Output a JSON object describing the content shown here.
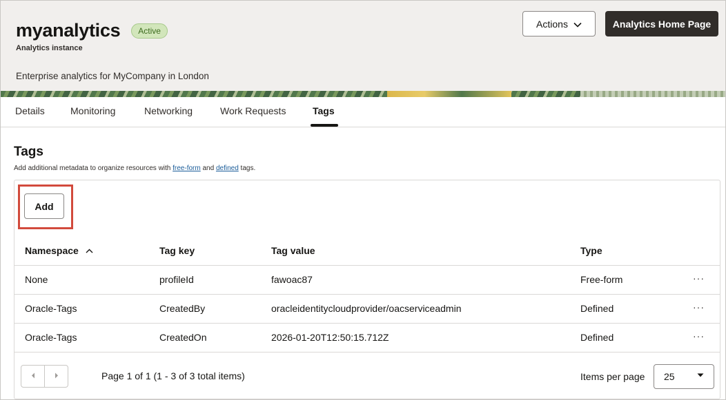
{
  "header": {
    "title": "myanalytics",
    "status": "Active",
    "subtitle": "Analytics instance",
    "description": "Enterprise analytics for MyCompany in London",
    "actions_label": "Actions",
    "home_label": "Analytics Home Page"
  },
  "tabs": [
    {
      "label": "Details"
    },
    {
      "label": "Monitoring"
    },
    {
      "label": "Networking"
    },
    {
      "label": "Work Requests"
    },
    {
      "label": "Tags",
      "active": true
    }
  ],
  "section": {
    "title": "Tags",
    "desc_prefix": "Add additional metadata to organize resources with ",
    "link_freeform": "free-form",
    "desc_and": " and ",
    "link_defined": "defined",
    "desc_suffix": " tags."
  },
  "toolbar": {
    "add_label": "Add"
  },
  "table": {
    "columns": [
      "Namespace",
      "Tag key",
      "Tag value",
      "Type"
    ],
    "rows": [
      {
        "namespace": "None",
        "key": "profileId",
        "value": "fawoac87",
        "type": "Free-form"
      },
      {
        "namespace": "Oracle-Tags",
        "key": "CreatedBy",
        "value": "oracleidentitycloudprovider/oacserviceadmin",
        "type": "Defined"
      },
      {
        "namespace": "Oracle-Tags",
        "key": "CreatedOn",
        "value": "2026-01-20T12:50:15.712Z",
        "type": "Defined"
      }
    ],
    "row_menu": "···"
  },
  "pager": {
    "page_info": "Page 1 of 1 (1 - 3 of 3 total items)",
    "items_per_page_label": "Items per page",
    "items_per_page": "25"
  },
  "icons": {
    "chevron_down": "chevron-down-icon",
    "sort_up": "sort-ascending-icon",
    "prev": "chevron-left-icon",
    "next": "chevron-right-icon",
    "kebab": "more-actions-icon",
    "caret": "caret-down-icon"
  },
  "colors": {
    "badge_bg": "#d2e6bb",
    "badge_text": "#3d6b1f",
    "primary_button": "#312d2a",
    "link": "#1a5c99",
    "highlight": "#d24a3c"
  }
}
